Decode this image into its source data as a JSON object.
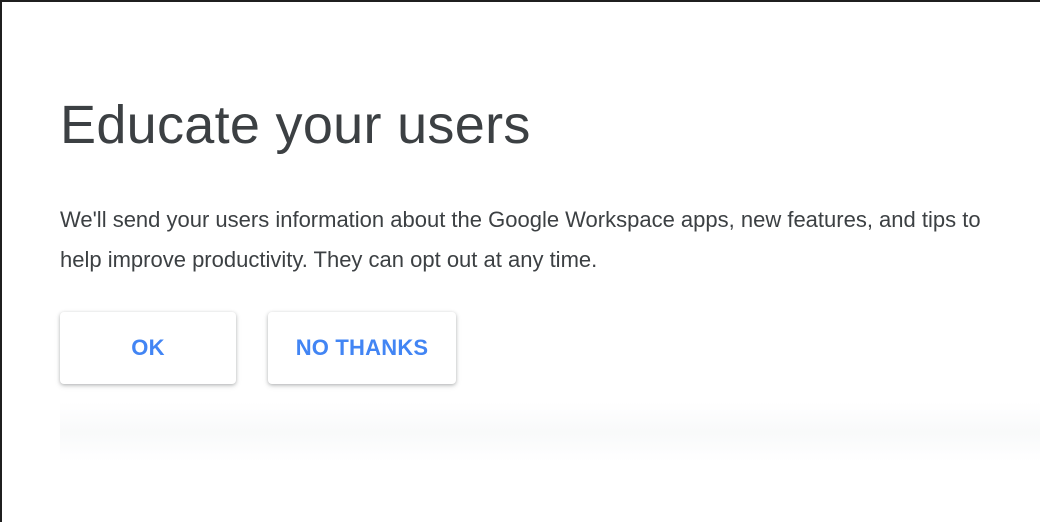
{
  "dialog": {
    "title": "Educate your users",
    "description": "We'll send your users information about the Google Workspace apps, new features, and tips to help improve productivity. They can opt out at any time.",
    "ok_label": "OK",
    "no_thanks_label": "NO THANKS"
  },
  "colors": {
    "accent": "#4285f4",
    "text": "#3c4043",
    "background": "#ffffff"
  }
}
